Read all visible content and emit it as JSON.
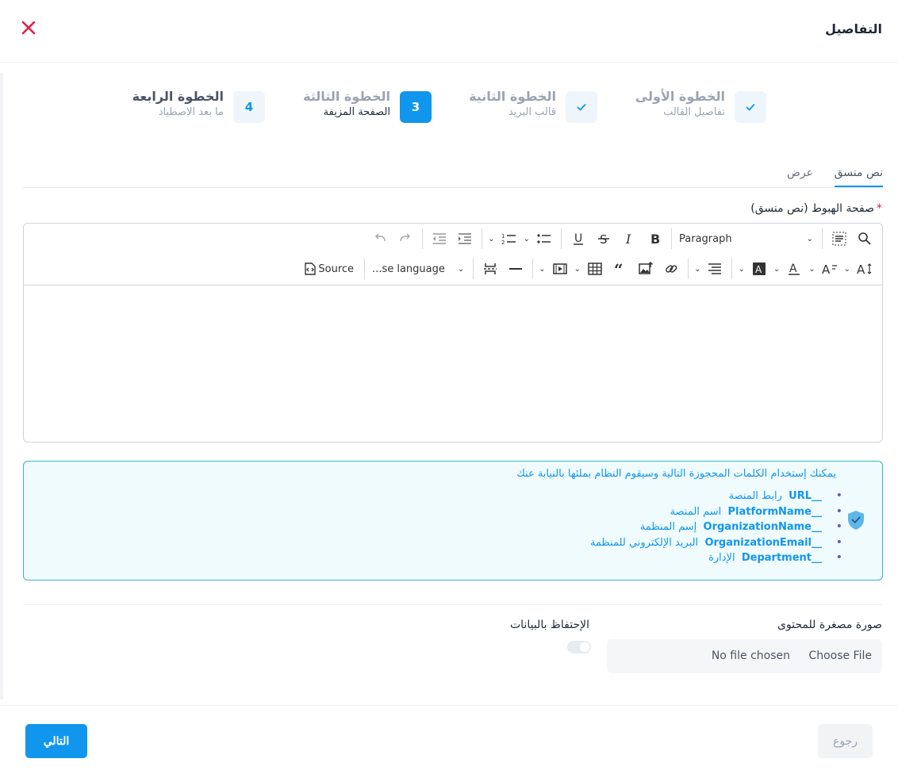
{
  "header": {
    "title": "التفاصيل"
  },
  "steps": [
    {
      "title": "الخطوة الأولى",
      "subtitle": "تفاصيل القالب",
      "marker": ""
    },
    {
      "title": "الخطوة الثانية",
      "subtitle": "قالب البريد",
      "marker": ""
    },
    {
      "title": "الخطوة الثالثة",
      "subtitle": "الصفحة المزيفة",
      "marker": "3"
    },
    {
      "title": "الخطوة الرابعة",
      "subtitle": "ما بعد الاصطياد",
      "marker": "4"
    }
  ],
  "tabs": [
    {
      "label": "نص منسق"
    },
    {
      "label": "عرض"
    }
  ],
  "field": {
    "label": "صفحة الهبوط (نص منسق)",
    "required_mark": "*"
  },
  "editor": {
    "paragraph_label": "Paragraph",
    "language_label": "...se language",
    "source_label": "Source"
  },
  "info": {
    "heading": "يمكنك إستخدام الكلمات المحجوزة التالية وسيقوم النظام بملئها بالنيابة عنك",
    "items": [
      {
        "keyword": "__URL",
        "description": "رابط المنصة"
      },
      {
        "keyword": "__PlatformName",
        "description": "اسم المنصة"
      },
      {
        "keyword": "__OrganizationName",
        "description": "إسم المنظمة"
      },
      {
        "keyword": "__OrganizationEmail",
        "description": "البريد الإلكتروني للمنظمة"
      },
      {
        "keyword": "__Department",
        "description": "الإدارة"
      }
    ]
  },
  "thumbnail": {
    "label": "صورة مصغرة للمحتوى",
    "choose_label": "Choose File",
    "none_label": "No file chosen"
  },
  "retain": {
    "label": "الإحتفاظ بالبيانات",
    "enabled": false
  },
  "footer": {
    "next_label": "التالي",
    "back_label": "رجوع"
  },
  "colors": {
    "accent": "#1196ee",
    "close": "#e11d48",
    "info_border": "#39b5c7"
  }
}
